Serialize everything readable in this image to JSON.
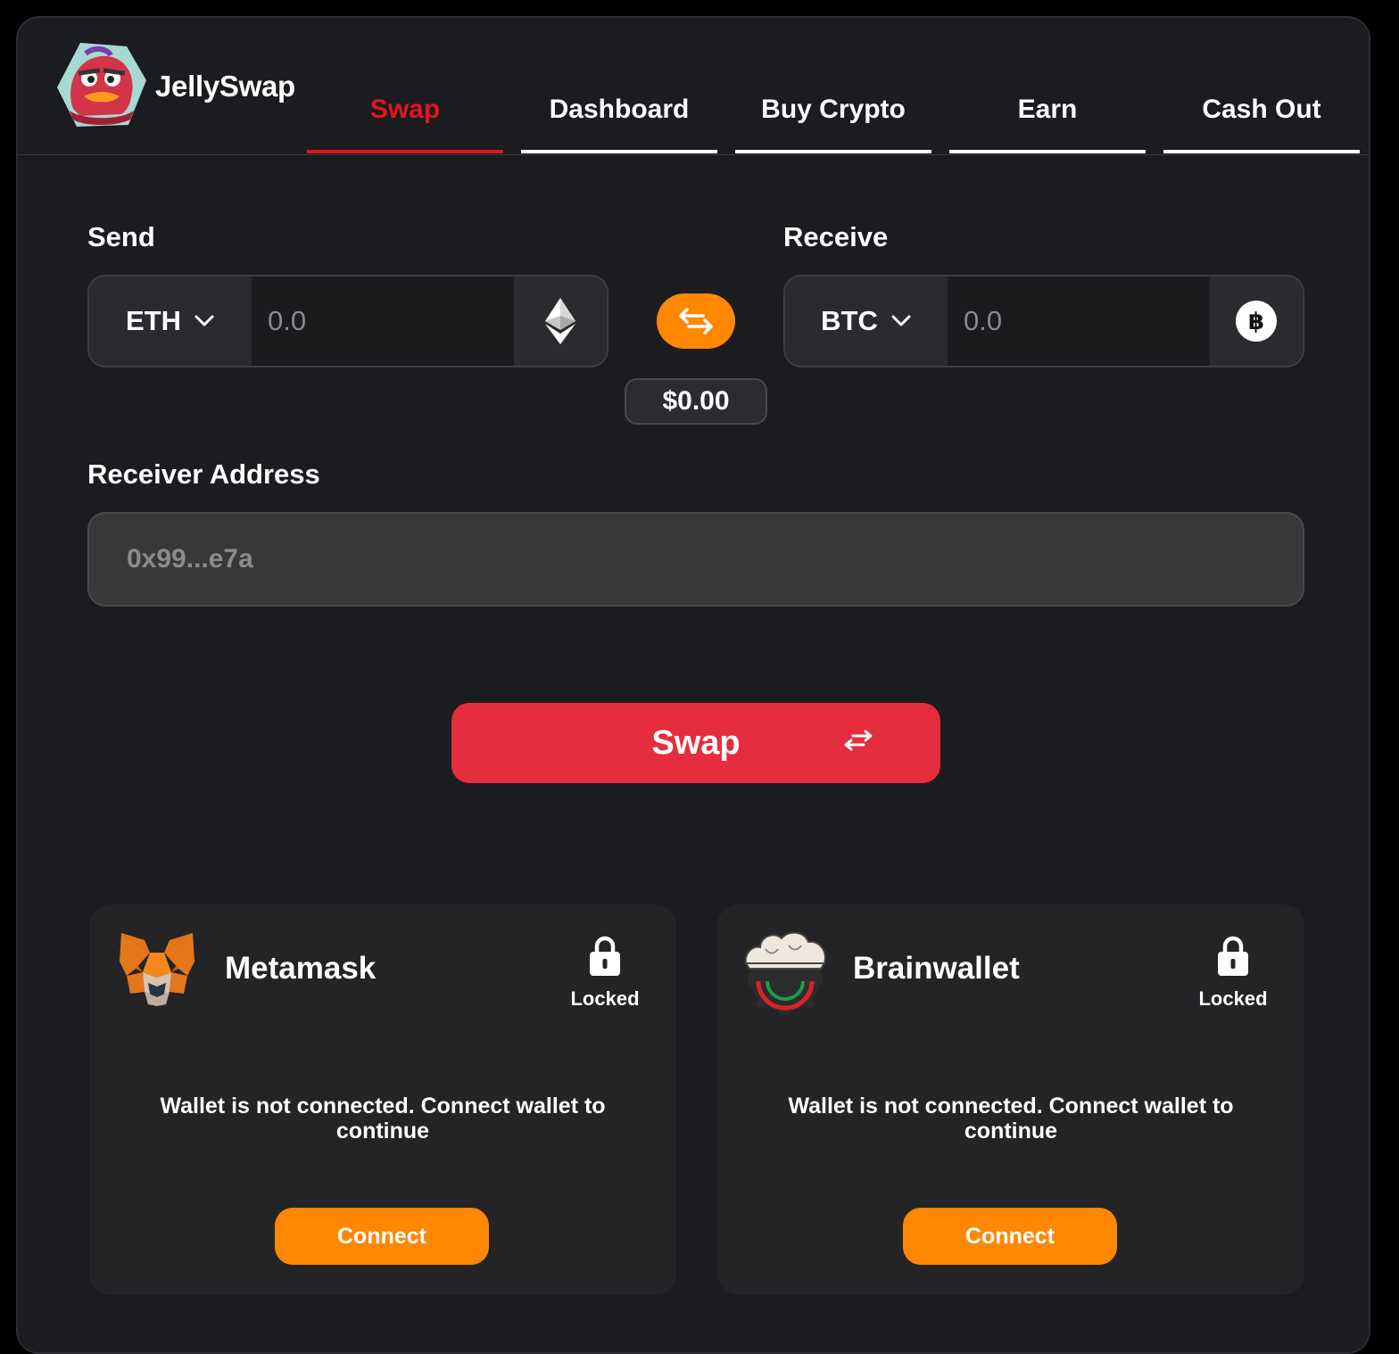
{
  "brand": {
    "name": "JellySwap"
  },
  "nav": {
    "tabs": [
      {
        "label": "Swap",
        "active": true
      },
      {
        "label": "Dashboard",
        "active": false
      },
      {
        "label": "Buy Crypto",
        "active": false
      },
      {
        "label": "Earn",
        "active": false
      },
      {
        "label": "Cash Out",
        "active": false
      }
    ]
  },
  "send": {
    "label": "Send",
    "token": "ETH",
    "amount_placeholder": "0.0",
    "coin_icon": "ethereum-icon"
  },
  "receive": {
    "label": "Receive",
    "token": "BTC",
    "amount_placeholder": "0.0",
    "coin_icon": "bitcoin-icon"
  },
  "usd_value": "$0.00",
  "receiver": {
    "label": "Receiver Address",
    "placeholder": "0x99...e7a"
  },
  "swap_button": {
    "label": "Swap"
  },
  "wallets": [
    {
      "name": "Metamask",
      "status": "Locked",
      "message": "Wallet is not connected. Connect wallet to continue",
      "button": "Connect"
    },
    {
      "name": "Brainwallet",
      "status": "Locked",
      "message": "Wallet is not connected. Connect wallet to continue",
      "button": "Connect"
    }
  ],
  "colors": {
    "accent_red": "#e0151c",
    "swap_button": "#e52d3e",
    "orange": "#ff8800",
    "background": "#1b1c1f"
  }
}
